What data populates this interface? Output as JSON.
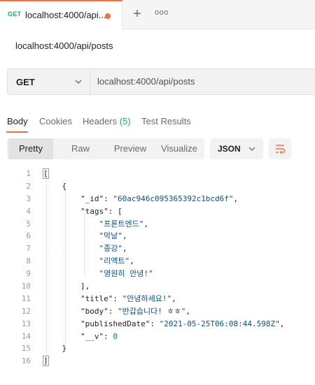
{
  "tab": {
    "method": "GET",
    "title": "localhost:4000/api...",
    "modified_indicator": "unsaved-dot"
  },
  "tab_actions": {
    "new_tab_icon": "plus-icon",
    "more_icon": "more-horizontal-icon"
  },
  "request": {
    "name": "localhost:4000/api/posts",
    "method": "GET",
    "url": "localhost:4000/api/posts"
  },
  "response_tabs": [
    {
      "label": "Body"
    },
    {
      "label": "Cookies"
    },
    {
      "label": "Headers ",
      "count": "(5)"
    },
    {
      "label": "Test Results"
    }
  ],
  "format_buttons": [
    "Pretty",
    "Raw",
    "Preview",
    "Visualize"
  ],
  "format_select": "JSON",
  "wrap_icon": "wrap-lines-icon",
  "colors": {
    "accent": "#ff6c37",
    "get_method": "#0cbb52",
    "json_string": "#0451a5",
    "json_number": "#098658"
  },
  "code_lines": [
    {
      "n": "1",
      "text": "["
    },
    {
      "n": "2",
      "text": "    {"
    },
    {
      "n": "3",
      "key": "\"_id\"",
      "val": "\"60ac946c095365392c1bcd6f\"",
      "end": ",",
      "indent": "        "
    },
    {
      "n": "4",
      "key": "\"tags\"",
      "val": "",
      "end": "[",
      "indent": "        "
    },
    {
      "n": "5",
      "val": "\"프론트엔드\"",
      "end": ",",
      "indent": "            "
    },
    {
      "n": "6",
      "val": "\"막날\"",
      "end": ",",
      "indent": "            "
    },
    {
      "n": "7",
      "val": "\"종강\"",
      "end": ",",
      "indent": "            "
    },
    {
      "n": "8",
      "val": "\"리액트\"",
      "end": ",",
      "indent": "            "
    },
    {
      "n": "9",
      "val": "\"영원히 안녕!\"",
      "end": "",
      "indent": "            "
    },
    {
      "n": "10",
      "text": "        ],"
    },
    {
      "n": "11",
      "key": "\"title\"",
      "val": "\"안녕하세요!\"",
      "end": ",",
      "indent": "        "
    },
    {
      "n": "12",
      "key": "\"body\"",
      "val": "\"반갑습니다! ㅎㅎ\"",
      "end": ",",
      "indent": "        "
    },
    {
      "n": "13",
      "key": "\"publishedDate\"",
      "val": "\"2021-05-25T06:08:44.598Z\"",
      "end": ",",
      "indent": "        "
    },
    {
      "n": "14",
      "key": "\"__v\"",
      "val": "0",
      "num": true,
      "end": "",
      "indent": "        "
    },
    {
      "n": "15",
      "text": "    }"
    },
    {
      "n": "16",
      "text": "]"
    }
  ]
}
